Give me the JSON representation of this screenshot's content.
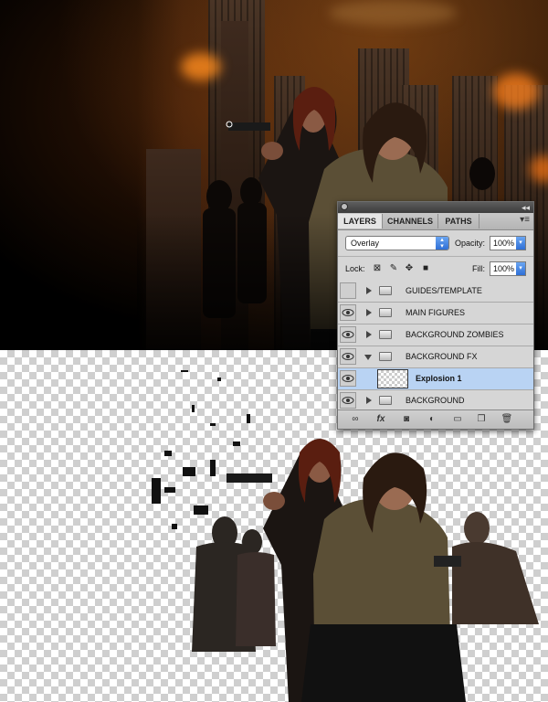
{
  "layers_panel": {
    "tabs": [
      "LAYERS",
      "CHANNELS",
      "PATHS"
    ],
    "active_tab": "LAYERS",
    "blend_mode": "Overlay",
    "opacity_label": "Opacity:",
    "opacity_value": "100%",
    "lock_label": "Lock:",
    "fill_label": "Fill:",
    "fill_value": "100%",
    "layers": [
      {
        "name": "GUIDES/TEMPLATE",
        "type": "group",
        "visible": false,
        "expanded": false
      },
      {
        "name": "MAIN FIGURES",
        "type": "group",
        "visible": true,
        "expanded": false
      },
      {
        "name": "BACKGROUND ZOMBIES",
        "type": "group",
        "visible": true,
        "expanded": false
      },
      {
        "name": "BACKGROUND FX",
        "type": "group",
        "visible": true,
        "expanded": true
      },
      {
        "name": "Explosion 1",
        "type": "layer",
        "visible": true,
        "selected": true
      },
      {
        "name": "BACKGROUND",
        "type": "group",
        "visible": true,
        "expanded": false
      }
    ],
    "bottom_icons": [
      "link-icon",
      "fx-icon",
      "mask-icon",
      "adjustment-icon",
      "new-group-icon",
      "new-layer-icon",
      "trash-icon"
    ]
  }
}
